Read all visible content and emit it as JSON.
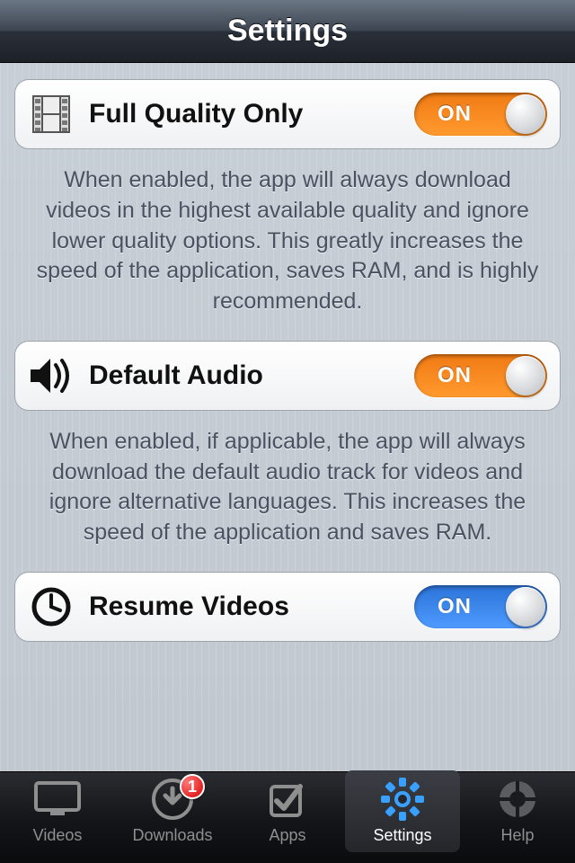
{
  "header": {
    "title": "Settings"
  },
  "toggles": {
    "on_label": "ON"
  },
  "rows": {
    "full_quality": {
      "label": "Full Quality Only",
      "state": "on",
      "color": "orange",
      "desc": "When enabled, the app will always download videos in the highest available quality and ignore lower quality options. This greatly increases the speed of the application, saves RAM, and is highly recommended."
    },
    "default_audio": {
      "label": "Default Audio",
      "state": "on",
      "color": "orange",
      "desc": "When enabled, if applicable, the app will always download the default audio track for videos and ignore alternative languages. This increases the speed of the application and saves RAM."
    },
    "resume_videos": {
      "label": "Resume Videos",
      "state": "on",
      "color": "blue"
    }
  },
  "tabs": {
    "videos": {
      "label": "Videos"
    },
    "downloads": {
      "label": "Downloads",
      "badge": "1"
    },
    "apps": {
      "label": "Apps"
    },
    "settings": {
      "label": "Settings"
    },
    "help": {
      "label": "Help"
    }
  }
}
